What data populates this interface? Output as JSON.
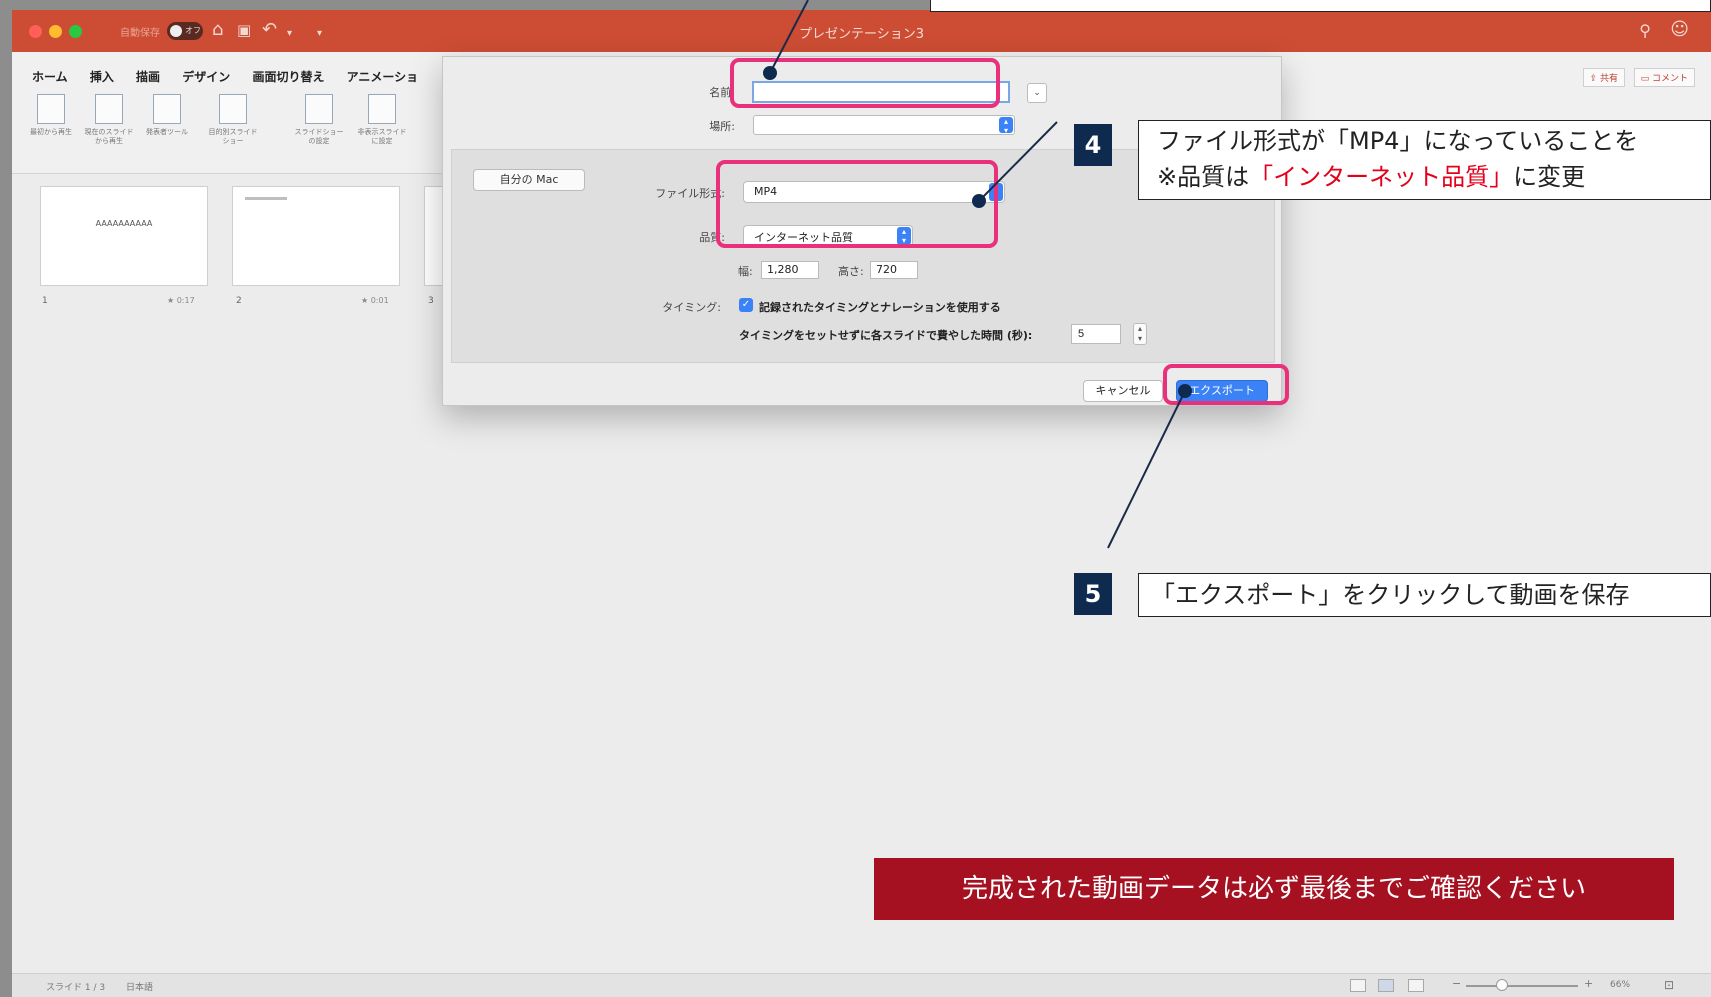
{
  "window": {
    "title": "プレゼンテーション3",
    "autosave_label": "自動保存",
    "autosave_state": "オフ"
  },
  "ribbon": {
    "tabs": [
      "ホーム",
      "挿入",
      "描画",
      "デザイン",
      "画面切り替え",
      "アニメーショ"
    ],
    "buttons": [
      {
        "label": "最初から再生"
      },
      {
        "label": "現在のスライドから再生"
      },
      {
        "label": "発表者ツール"
      },
      {
        "label": "目的別スライドショー"
      },
      {
        "label": "スライドショーの設定"
      },
      {
        "label": "非表示スライドに設定"
      }
    ],
    "share_label": "共有",
    "comment_label": "コメント"
  },
  "thumbnails": [
    {
      "number": "1",
      "text": "AAAAAAAAAA",
      "duration": "0:17"
    },
    {
      "number": "2",
      "text": "",
      "duration": "0:01"
    },
    {
      "number": "3"
    }
  ],
  "dialog": {
    "name_label": "名前:",
    "name_value": "",
    "location_label": "場所:",
    "mymac_label": "自分の Mac",
    "format_label": "ファイル形式:",
    "format_value": "MP4",
    "quality_label": "品質:",
    "quality_value": "インターネット品質",
    "width_label": "幅:",
    "width_value": "1,280",
    "height_label": "高さ:",
    "height_value": "720",
    "timing_label": "タイミング:",
    "timing_option": "記録されたタイミングとナレーションを使用する",
    "seconds_label": "タイミングをセットせずに各スライドで費やした時間 (秒):",
    "seconds_value": "5",
    "cancel_label": "キャンセル",
    "export_label": "エクスポート"
  },
  "status": {
    "slide": "スライド 1 / 3",
    "language": "日本語",
    "zoom": "66%"
  },
  "callouts": {
    "step4_number": "4",
    "step4_line1": "ファイル形式が「MP4」になっていることを",
    "step4_line2_prefix": "※品質は",
    "step4_line2_highlight": "「インターネット品質」",
    "step4_line2_suffix": "に変更",
    "step5_number": "5",
    "step5_text": "「エクスポート」をクリックして動画を保存",
    "final_note": "完成された動画データは必ず最後までご確認ください"
  },
  "colors": {
    "titlebar": "#cc4d33",
    "highlight": "#e8307b",
    "step_badge": "#0f2a4f",
    "note_bg": "#a51121",
    "accent_blue": "#3b82f6",
    "emphasis_red": "#e3001b"
  }
}
